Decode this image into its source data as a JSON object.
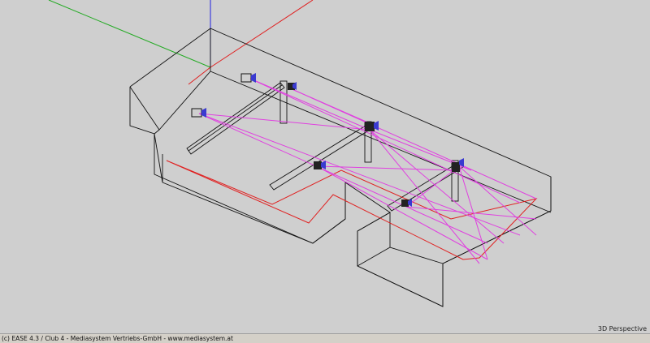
{
  "viewport": {
    "view_mode_label": "3D Perspective",
    "axis_colors": {
      "x": "#e02020",
      "y": "#22aa22",
      "z": "#2020e0"
    },
    "wireframe_color": "#111111",
    "ray_color": "#e040e0",
    "audience_area_color": "#e02020",
    "background_color": "#cfcfcf"
  },
  "status_bar": {
    "text": "(c) EASE 4.3 / Club 4 - Mediasystem Vertriebs-GmbH - www.mediasystem.at"
  }
}
